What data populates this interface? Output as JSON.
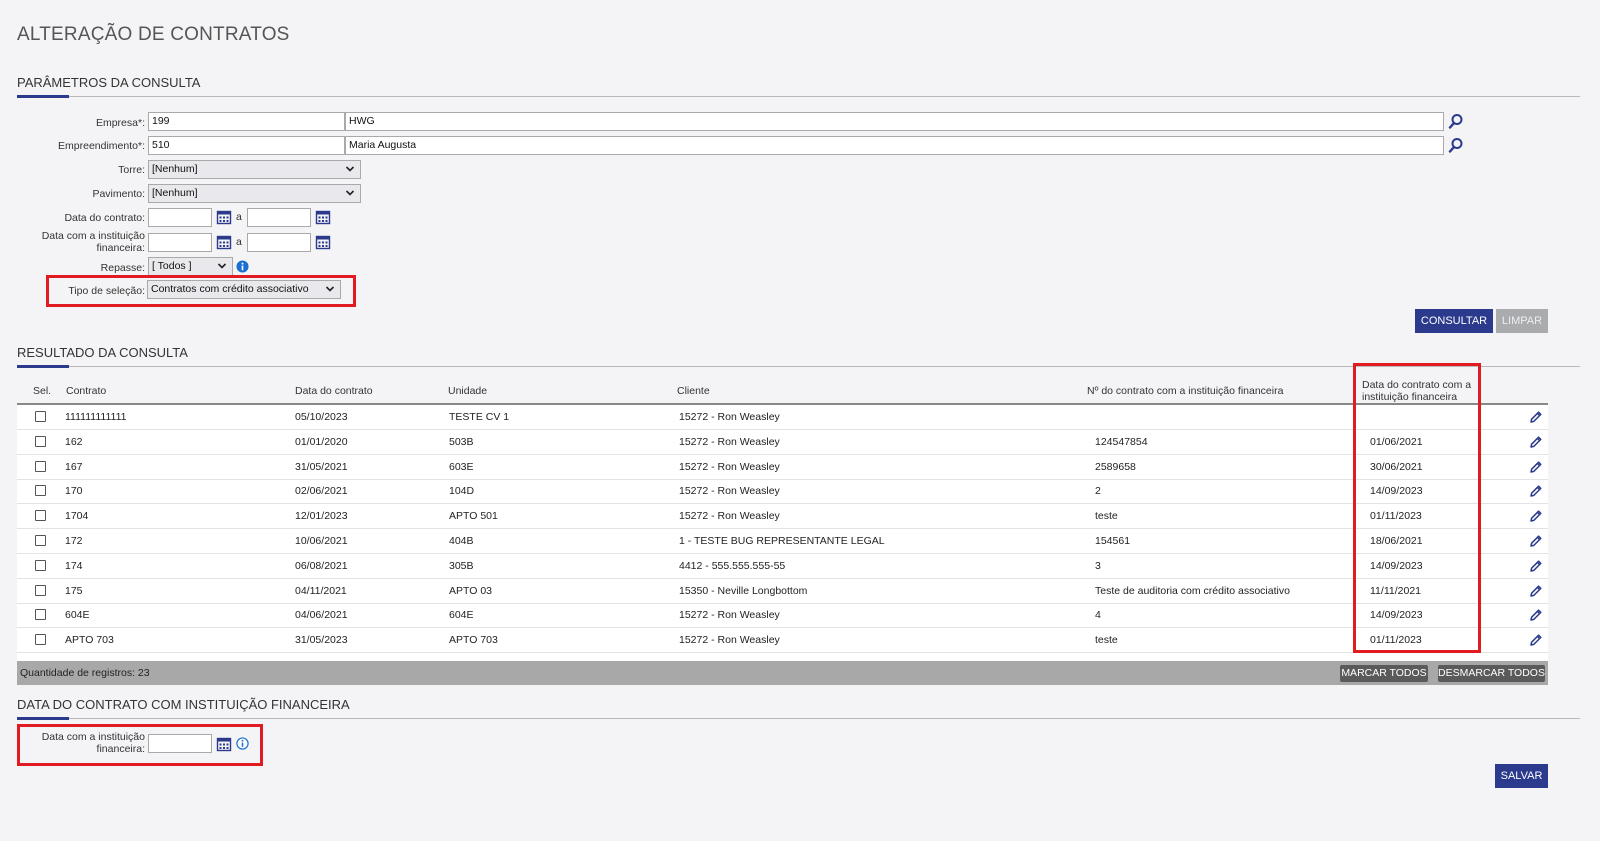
{
  "page_title": "ALTERAÇÃO DE CONTRATOS",
  "params": {
    "section_title": "PARÂMETROS DA CONSULTA",
    "empresa_label": "Empresa*:",
    "empresa_code": "199",
    "empresa_name": "HWG",
    "empreendimento_label": "Empreendimento*:",
    "empreendimento_code": "510",
    "empreendimento_name": "Maria Augusta",
    "torre_label": "Torre:",
    "torre_value": "[Nenhum]",
    "pavimento_label": "Pavimento:",
    "pavimento_value": "[Nenhum]",
    "data_contrato_label": "Data do contrato:",
    "data_inst_label_line1": "Data com a instituição",
    "data_inst_label_line2": "financeira:",
    "range_sep": "a",
    "repasse_label": "Repasse:",
    "repasse_value": "[ Todos ]",
    "tipo_selecao_label": "Tipo de seleção:",
    "tipo_selecao_value": "Contratos com crédito associativo",
    "consultar_label": "CONSULTAR",
    "limpar_label": "LIMPAR"
  },
  "results": {
    "section_title": "RESULTADO DA CONSULTA",
    "columns": {
      "sel": "Sel.",
      "contrato": "Contrato",
      "data_contrato": "Data do contrato",
      "unidade": "Unidade",
      "cliente": "Cliente",
      "num_contrato_inst": "Nº do contrato com a instituição financeira",
      "data_inst_line1": "Data do contrato com a",
      "data_inst_line2": "instituição financeira"
    },
    "rows": [
      {
        "contrato": "111111111111",
        "data": "05/10/2023",
        "unidade": "TESTE CV 1",
        "cliente": "15272 - Ron Weasley",
        "num": "",
        "data_inst": ""
      },
      {
        "contrato": "162",
        "data": "01/01/2020",
        "unidade": "503B",
        "cliente": "15272 - Ron Weasley",
        "num": "124547854",
        "data_inst": "01/06/2021"
      },
      {
        "contrato": "167",
        "data": "31/05/2021",
        "unidade": "603E",
        "cliente": "15272 - Ron Weasley",
        "num": "2589658",
        "data_inst": "30/06/2021"
      },
      {
        "contrato": "170",
        "data": "02/06/2021",
        "unidade": "104D",
        "cliente": "15272 - Ron Weasley",
        "num": "2",
        "data_inst": "14/09/2023"
      },
      {
        "contrato": "1704",
        "data": "12/01/2023",
        "unidade": "APTO 501",
        "cliente": "15272 - Ron Weasley",
        "num": "teste",
        "data_inst": "01/11/2023"
      },
      {
        "contrato": "172",
        "data": "10/06/2021",
        "unidade": "404B",
        "cliente": "1 - TESTE BUG REPRESENTANTE LEGAL",
        "num": "154561",
        "data_inst": "18/06/2021"
      },
      {
        "contrato": "174",
        "data": "06/08/2021",
        "unidade": "305B",
        "cliente": "4412 - 555.555.555-55",
        "num": "3",
        "data_inst": "14/09/2023"
      },
      {
        "contrato": "175",
        "data": "04/11/2021",
        "unidade": "APTO 03",
        "cliente": "15350 - Neville Longbottom",
        "num": "Teste de auditoria com crédito associativo",
        "data_inst": "11/11/2021"
      },
      {
        "contrato": "604E",
        "data": "04/06/2021",
        "unidade": "604E",
        "cliente": "15272 - Ron Weasley",
        "num": "4",
        "data_inst": "14/09/2023"
      },
      {
        "contrato": "APTO 703",
        "data": "31/05/2023",
        "unidade": "APTO 703",
        "cliente": "15272 - Ron Weasley",
        "num": "teste",
        "data_inst": "01/11/2023"
      }
    ],
    "count_label": "Quantidade de registros: 23",
    "marcar_todos": "MARCAR TODOS",
    "desmarcar_todos": "DESMARCAR TODOS"
  },
  "bottom": {
    "section_title": "DATA DO CONTRATO COM INSTITUIÇÃO FINANCEIRA",
    "data_label_line1": "Data com a instituição",
    "data_label_line2": "financeira:",
    "salvar_label": "SALVAR"
  },
  "colors": {
    "accent": "#2b3a8c",
    "highlight": "#e01b22"
  }
}
